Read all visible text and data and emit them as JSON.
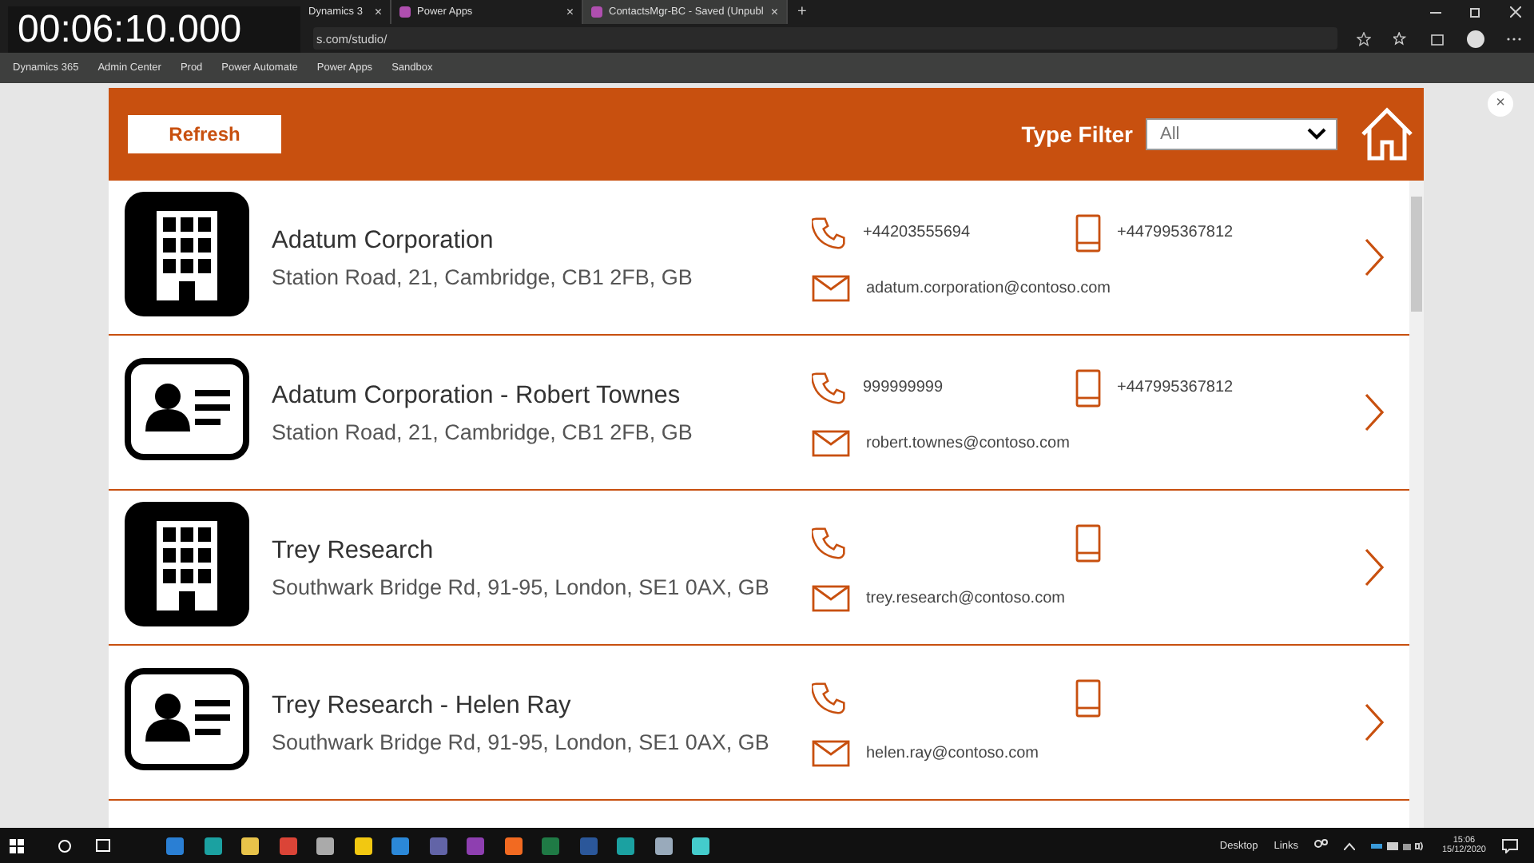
{
  "video_timer": "00:06:10.000",
  "browser": {
    "tabs": [
      {
        "title": "Dynamics 3",
        "close": "×",
        "selected": false
      },
      {
        "title": "Power Apps",
        "close": "×",
        "selected": false
      },
      {
        "title": "ContactsMgr-BC - Saved (Unpubl",
        "close": "×",
        "selected": true
      }
    ],
    "new_tab": "+",
    "address": "s.com/studio/",
    "bookmarks": [
      "Dynamics 365",
      "Admin Center",
      "Prod",
      "Power Automate",
      "Power Apps",
      "Sandbox"
    ]
  },
  "app": {
    "close_button": "×",
    "refresh_button": "Refresh",
    "filter_label": "Type Filter",
    "filter_value": "All",
    "rows": [
      {
        "kind": "account",
        "name": "Adatum Corporation",
        "address": "Station Road, 21, Cambridge, CB1 2FB, GB",
        "phone": "+44203555694",
        "mobile": "+447995367812",
        "email": "adatum.corporation@contoso.com"
      },
      {
        "kind": "contact",
        "name": "Adatum Corporation - Robert Townes",
        "address": "Station Road, 21, Cambridge, CB1 2FB, GB",
        "phone": "999999999",
        "mobile": "+447995367812",
        "email": "robert.townes@contoso.com"
      },
      {
        "kind": "account",
        "name": "Trey Research",
        "address": "Southwark Bridge Rd, 91-95, London, SE1 0AX, GB",
        "email": "trey.research@contoso.com"
      },
      {
        "kind": "contact",
        "name": "Trey Research - Helen Ray",
        "address": "Southwark Bridge Rd, 91-95, London, SE1 0AX, GB",
        "email": "helen.ray@contoso.com"
      }
    ]
  },
  "taskbar": {
    "toolbars": [
      "Desktop",
      "Links"
    ],
    "time": "15:06",
    "date": "15/12/2020"
  }
}
